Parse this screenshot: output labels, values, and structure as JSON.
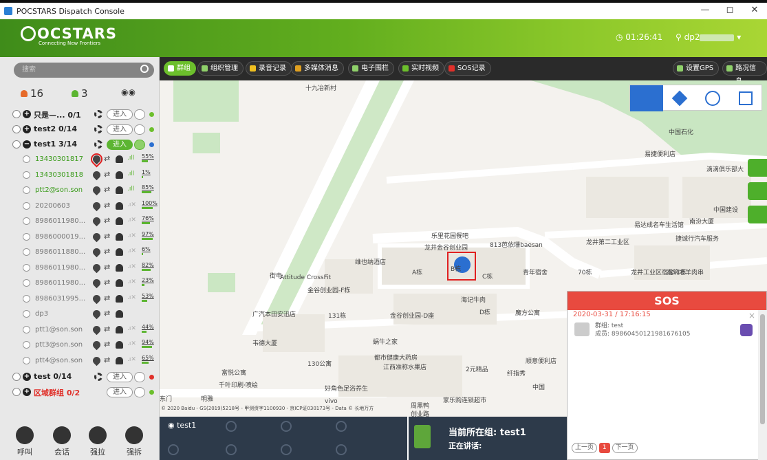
{
  "window": {
    "title": "POCSTARS Dispatch Console",
    "buttons": [
      "—",
      "◻",
      "✕"
    ]
  },
  "header": {
    "logo": "OCSTARS",
    "tagline": "Connecting New Frontiers",
    "clock": "01:26:41",
    "user": "dp2"
  },
  "sidebar": {
    "search_placeholder": "搜索",
    "counts": {
      "offline": "16",
      "online": "3"
    },
    "groups": [
      {
        "name": "只是—... 0/1",
        "expanded": false,
        "enter": "进入",
        "red": false,
        "dot": "#6cbf2c"
      },
      {
        "name": "test2 0/14",
        "expanded": false,
        "enter": "进入",
        "red": false,
        "dot": "#6cbf2c"
      },
      {
        "name": "test1 3/14",
        "expanded": true,
        "enter": "进入",
        "red": false,
        "dot": "#2b6fd0"
      },
      {
        "name": "test 0/14",
        "expanded": false,
        "enter": "进入",
        "red": false,
        "dot": "#e0302a"
      },
      {
        "name": "区域群组 0/2",
        "expanded": false,
        "enter": "进入",
        "red": true,
        "dot": "#6cbf2c"
      }
    ],
    "members": [
      {
        "name": "13430301817",
        "online": true,
        "battery": "55%"
      },
      {
        "name": "13430301818",
        "online": true,
        "battery": "1%"
      },
      {
        "name": "ptt2@son.son",
        "online": true,
        "battery": "85%"
      },
      {
        "name": "20200603",
        "online": false,
        "battery": "100%"
      },
      {
        "name": "8986011980...",
        "online": false,
        "battery": "76%"
      },
      {
        "name": "8986000019...",
        "online": false,
        "battery": "97%"
      },
      {
        "name": "8986011880...",
        "online": false,
        "battery": "6%"
      },
      {
        "name": "8986011980...",
        "online": false,
        "battery": "82%"
      },
      {
        "name": "8986011980...",
        "online": false,
        "battery": "23%"
      },
      {
        "name": "8986031995...",
        "online": false,
        "battery": "53%"
      },
      {
        "name": "dp3",
        "online": false,
        "battery": ""
      },
      {
        "name": "ptt1@son.son",
        "online": false,
        "battery": "44%"
      },
      {
        "name": "ptt3@son.son",
        "online": false,
        "battery": "94%"
      },
      {
        "name": "ptt4@son.son",
        "online": false,
        "battery": "65%"
      }
    ],
    "bottom_buttons": [
      "呼叫",
      "会话",
      "强拉",
      "强拆"
    ]
  },
  "toolbar": {
    "tabs": [
      "群组",
      "组织管理",
      "录音记录",
      "多媒体消息",
      "电子围栏",
      "实时视频",
      "SOS记录"
    ],
    "right": [
      "设置GPS",
      "路况信息"
    ]
  },
  "map": {
    "labels": [
      "十九冶新村",
      "中国石化",
      "易捷便利店",
      "滴滴俱乐部大",
      "南汾大厦",
      "中国建设",
      "易达成名车生活馆",
      "捷诚行汽车服务",
      "龙井第二工业区",
      "乐里花园餐吧",
      "龙井金谷创业园",
      "813芭依珊baesan",
      "维也纳酒店",
      "Attitude CrossFit",
      "A栋",
      "B栋",
      "C栋",
      "青年宿舍",
      "70栋",
      "龙井工业区宿舍-1栋",
      "高筑墙羊肉串",
      "街电",
      "金谷创业园-F栋",
      "海记牛肉",
      "D栋",
      "魔方公寓",
      "广汽本田安迅店",
      "金谷创业园-D座",
      "131栋",
      "韦德大厦",
      "蜗牛之家",
      "130公寓",
      "都市健康大药房",
      "2元精品",
      "顺意便利店",
      "富悦公寓",
      "江西准称水果店",
      "纤指秀",
      "千叶印刷·喷绘",
      "好角色足浴养生",
      "中国",
      "明雅",
      "东门",
      "vivo",
      "周黑鸭",
      "家乐购连锁超市",
      "© 2020 Baidu - GS(2019)5218号 - 甲测资字1100930 - 京ICP证030173号 - Data © 长地万方",
      "创业路"
    ]
  },
  "sos": {
    "title": "SOS",
    "time": "2020-03-31 / 17:16:15",
    "group_label": "群组: test",
    "member_label": "成员: 89860450121981676105",
    "prev": "上一页",
    "page": "1",
    "next": "下一页"
  },
  "bottombar": {
    "group_name": "test1",
    "current_group": "当前所在组: test1",
    "speaking": "正在讲话:"
  }
}
